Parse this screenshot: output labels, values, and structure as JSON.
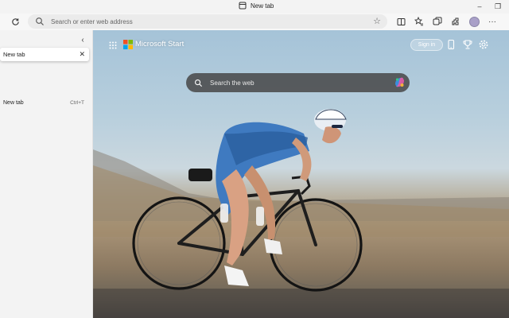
{
  "window": {
    "title": "New tab",
    "minimize_glyph": "–",
    "restore_glyph": "❐"
  },
  "toolbar": {
    "address_placeholder": "Search or enter web address",
    "icons": [
      "refresh-icon",
      "search-icon",
      "favorite-star-icon",
      "split-screen-icon",
      "favorites-icon",
      "collections-icon",
      "extensions-icon",
      "profile-avatar",
      "more-icon"
    ]
  },
  "sidebar": {
    "active_tab": "New tab",
    "close_glyph": "✕",
    "collapse_glyph": "‹",
    "menu_item": {
      "label": "New tab",
      "shortcut": "Ctrl+T"
    }
  },
  "start": {
    "brand": "Microsoft Start",
    "signin": "Sign in",
    "search_placeholder": "Search the web",
    "background": "cyclist-on-desert-road"
  },
  "colors": {
    "ms_red": "#f25022",
    "ms_green": "#7fba00",
    "ms_blue": "#00a4ef",
    "ms_yellow": "#ffb900"
  }
}
